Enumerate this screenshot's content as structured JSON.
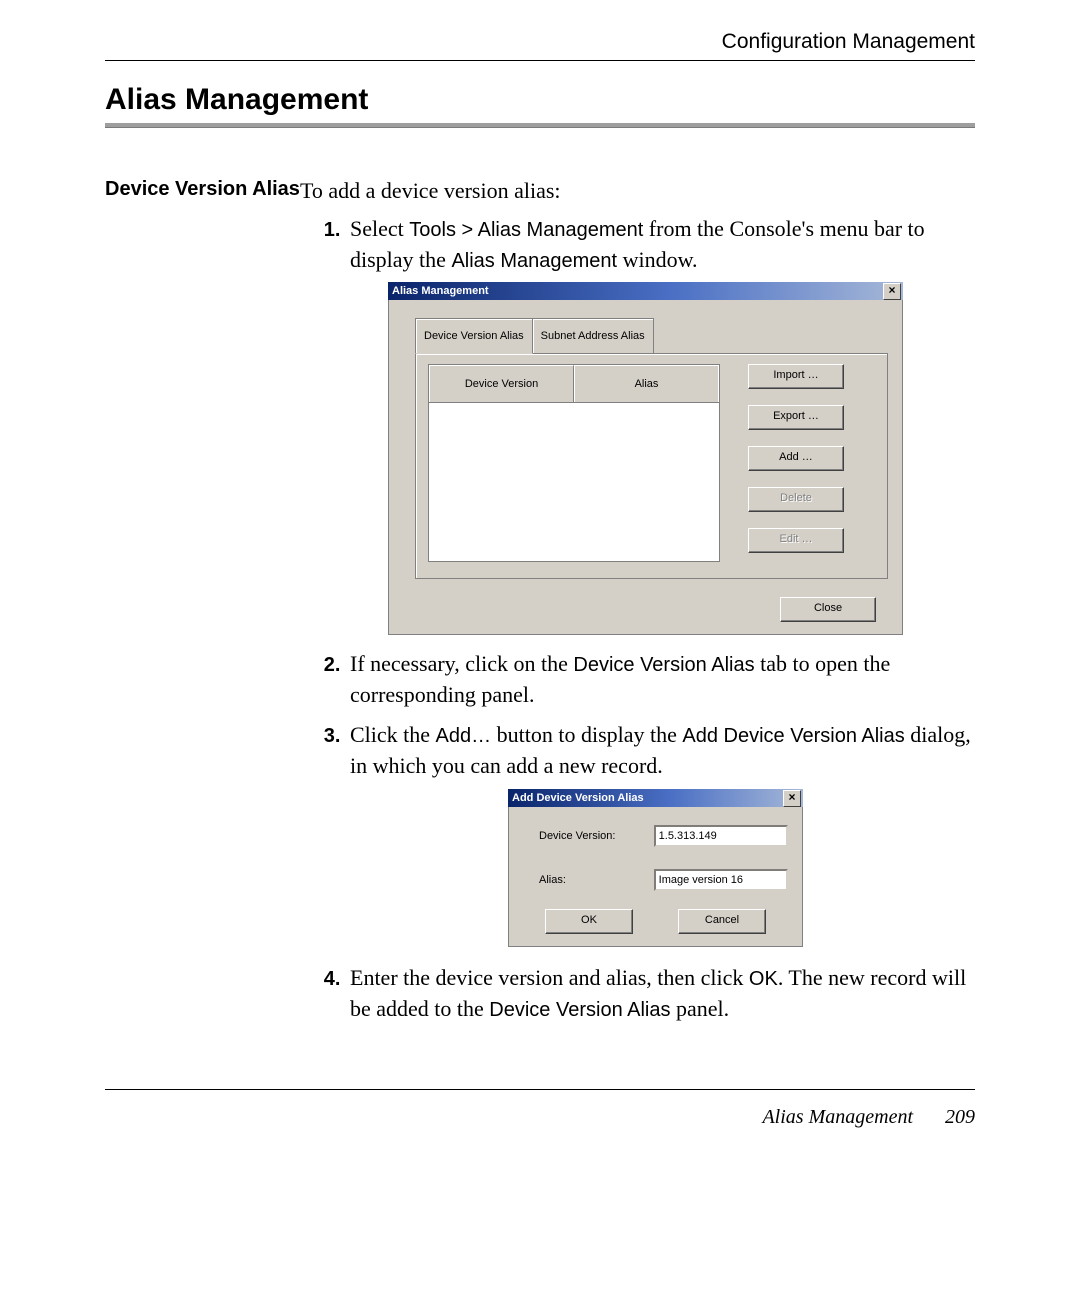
{
  "header": {
    "right": "Configuration Management"
  },
  "section_title": "Alias Management",
  "side_heading": "Device Version Alias",
  "intro": "To add a device version alias:",
  "steps": {
    "s1a": "Select ",
    "s1_menu": "Tools > Alias Management",
    "s1b": " from the Console's menu bar to display the ",
    "s1_win": "Alias Management",
    "s1c": " window.",
    "s2a": "If necessary, click on the ",
    "s2_tab": "Device Version Alias",
    "s2b": " tab to open the corresponding panel.",
    "s3a": "Click the ",
    "s3_btn": "Add…",
    "s3b": " button to display the ",
    "s3_dlg": "Add Device Version Alias",
    "s3c": " dialog, in which you can add a new record.",
    "s4a": "Enter the device version and alias, then click ",
    "s4_ok": "OK",
    "s4b": ". The new record will be added to the ",
    "s4_panel": "Device Version Alias",
    "s4c": " panel."
  },
  "win1": {
    "title": "Alias Management",
    "close_glyph": "×",
    "tabs": {
      "active": "Device Version Alias",
      "inactive": "Subnet Address Alias"
    },
    "cols": {
      "c1": "Device Version",
      "c2": "Alias"
    },
    "buttons": {
      "import": "Import …",
      "export": "Export …",
      "add": "Add …",
      "delete": "Delete",
      "edit": "Edit …",
      "close": "Close"
    }
  },
  "win2": {
    "title": "Add Device Version Alias",
    "close_glyph": "×",
    "labels": {
      "dv": "Device Version:",
      "al": "Alias:"
    },
    "values": {
      "dv": "1.5.313.149",
      "al": "Image version 16"
    },
    "buttons": {
      "ok": "OK",
      "cancel": "Cancel"
    }
  },
  "footer": {
    "section": "Alias Management",
    "page": "209"
  }
}
